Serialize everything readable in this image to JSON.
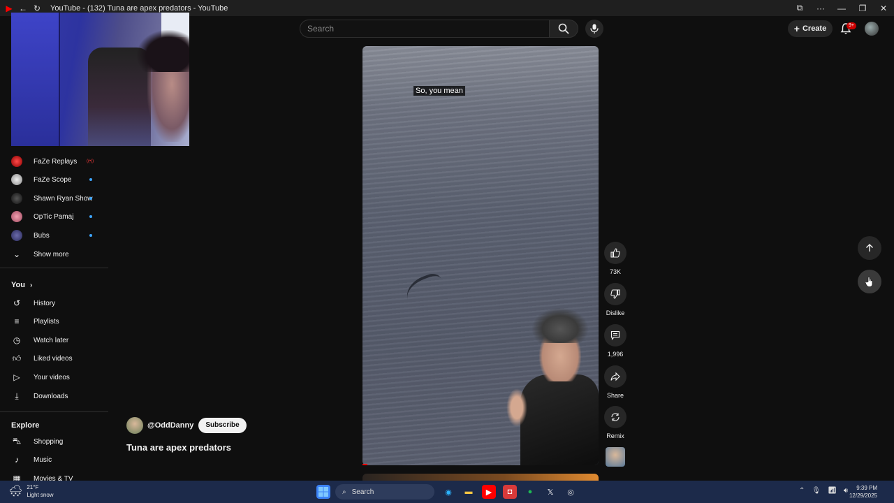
{
  "window": {
    "title": "YouTube - (132) Tuna are apex predators - YouTube"
  },
  "masthead": {
    "search_placeholder": "Search",
    "create_label": "Create",
    "notifications_badge": "9+"
  },
  "sidebar": {
    "subscriptions": [
      {
        "label": "FaZe Replays",
        "status": "live"
      },
      {
        "label": "FaZe Scope",
        "status": "new"
      },
      {
        "label": "Shawn Ryan Show",
        "status": "new"
      },
      {
        "label": "OpTic Pamaj",
        "status": "new"
      },
      {
        "label": "Bubs",
        "status": "new"
      }
    ],
    "show_more": "Show more",
    "you_heading": "You",
    "you_items": [
      {
        "label": "History",
        "icon": "history-icon"
      },
      {
        "label": "Playlists",
        "icon": "playlists-icon"
      },
      {
        "label": "Watch later",
        "icon": "clock-icon"
      },
      {
        "label": "Liked videos",
        "icon": "thumbs-up-icon"
      },
      {
        "label": "Your videos",
        "icon": "play-square-icon"
      },
      {
        "label": "Downloads",
        "icon": "download-icon"
      }
    ],
    "explore_heading": "Explore",
    "explore_items": [
      {
        "label": "Shopping",
        "icon": "shopping-bag-icon"
      },
      {
        "label": "Music",
        "icon": "music-note-icon"
      },
      {
        "label": "Movies & TV",
        "icon": "film-icon"
      }
    ]
  },
  "short": {
    "channel_handle": "@OddDanny",
    "subscribe_label": "Subscribe",
    "title": "Tuna are apex predators",
    "caption": "So, you mean",
    "likes": "73K",
    "dislike_label": "Dislike",
    "comments": "1,996",
    "share_label": "Share",
    "remix_label": "Remix",
    "progress_fraction": 0.02
  },
  "taskbar": {
    "weather_temp": "21°F",
    "weather_desc": "Light snow",
    "search_label": "Search",
    "time": "9:39 PM",
    "date": "12/29/2025"
  }
}
